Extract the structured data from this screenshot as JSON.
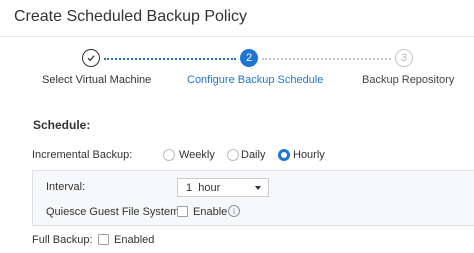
{
  "title": "Create Scheduled Backup Policy",
  "stepper": {
    "steps": [
      {
        "number": "1",
        "label": "Select Virtual Machine",
        "state": "completed",
        "icon": "check-icon"
      },
      {
        "number": "2",
        "label": "Configure Backup Schedule",
        "state": "active"
      },
      {
        "number": "3",
        "label": "Backup Repository",
        "state": "pending"
      }
    ]
  },
  "schedule": {
    "section_title": "Schedule:",
    "incremental": {
      "label": "Incremental Backup:",
      "options": [
        {
          "label": "Weekly",
          "selected": false
        },
        {
          "label": "Daily",
          "selected": false
        },
        {
          "label": "Hourly",
          "selected": true
        }
      ],
      "interval": {
        "label": "Interval:",
        "value": "1  hour"
      },
      "quiesce": {
        "label": "Quiesce Guest File System:",
        "checkbox_label": "Enable",
        "checked": false,
        "info_icon": "info-icon"
      }
    },
    "full_backup": {
      "label": "Full Backup:",
      "checkbox_label": "Enabled",
      "checked": false
    }
  },
  "colors": {
    "accent": "#1f76d2",
    "text": "#333333",
    "muted": "#b5b8bd",
    "panel_bg": "#f7f8fa",
    "border": "#dfe1e5"
  }
}
